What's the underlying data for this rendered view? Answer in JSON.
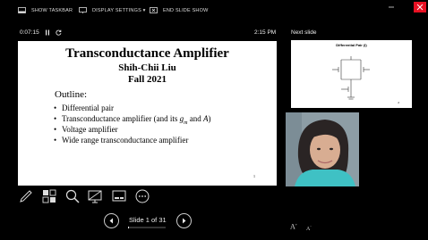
{
  "toolbar": {
    "show_taskbar": "SHOW TASKBAR",
    "display_settings": "DISPLAY SETTINGS ▾",
    "end_slide_show": "END SLIDE SHOW"
  },
  "timer": {
    "elapsed": "0:07:15",
    "clock": "2:15 PM"
  },
  "next_slide": {
    "label": "Next slide",
    "title": "Differential Pair (I)",
    "page_number": "2"
  },
  "current_slide": {
    "title": "Transconductance Amplifier",
    "author": "Shih-Chii Liu",
    "term": "Fall 2021",
    "outline_heading": "Outline:",
    "bullets": [
      "Differential pair",
      "Voltage amplifier",
      "Wide range transconductance amplifier"
    ],
    "bullet_2_text": "Transconductance amplifier (and its ",
    "bullet_2_gm": "g",
    "bullet_2_gm_sub": "m",
    "bullet_2_and": " and ",
    "bullet_2_a": "A",
    "bullet_2_end": ")",
    "page_number": "1"
  },
  "navigation": {
    "slide_counter": "Slide 1 of 31",
    "current": 1,
    "total": 31,
    "progress_fraction": 0.032
  },
  "font_buttons": {
    "increase": "A",
    "decrease": "A"
  },
  "icons": [
    "taskbar-icon",
    "display-settings-icon",
    "end-show-icon",
    "pen-icon",
    "slides-grid-icon",
    "zoom-icon",
    "screen-black-icon",
    "subtitles-icon",
    "more-options-icon",
    "prev-arrow-icon",
    "next-arrow-icon"
  ],
  "colors": {
    "background": "#000000",
    "slide_bg": "#ffffff",
    "close_button": "#e81123"
  }
}
